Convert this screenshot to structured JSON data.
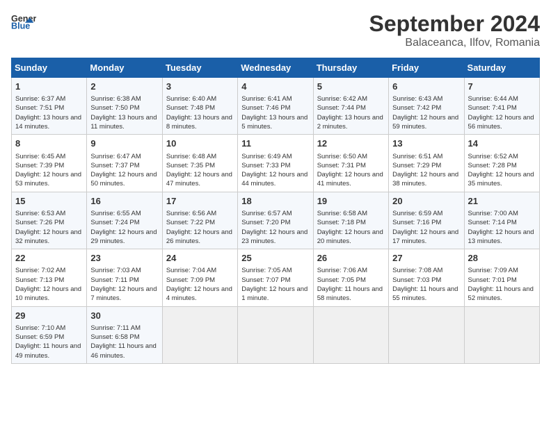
{
  "header": {
    "logo_general": "General",
    "logo_blue": "Blue",
    "month": "September 2024",
    "location": "Balaceanca, Ilfov, Romania"
  },
  "days_of_week": [
    "Sunday",
    "Monday",
    "Tuesday",
    "Wednesday",
    "Thursday",
    "Friday",
    "Saturday"
  ],
  "weeks": [
    [
      {
        "day": "1",
        "sunrise": "6:37 AM",
        "sunset": "7:51 PM",
        "daylight": "13 hours and 14 minutes."
      },
      {
        "day": "2",
        "sunrise": "6:38 AM",
        "sunset": "7:50 PM",
        "daylight": "13 hours and 11 minutes."
      },
      {
        "day": "3",
        "sunrise": "6:40 AM",
        "sunset": "7:48 PM",
        "daylight": "13 hours and 8 minutes."
      },
      {
        "day": "4",
        "sunrise": "6:41 AM",
        "sunset": "7:46 PM",
        "daylight": "13 hours and 5 minutes."
      },
      {
        "day": "5",
        "sunrise": "6:42 AM",
        "sunset": "7:44 PM",
        "daylight": "13 hours and 2 minutes."
      },
      {
        "day": "6",
        "sunrise": "6:43 AM",
        "sunset": "7:42 PM",
        "daylight": "12 hours and 59 minutes."
      },
      {
        "day": "7",
        "sunrise": "6:44 AM",
        "sunset": "7:41 PM",
        "daylight": "12 hours and 56 minutes."
      }
    ],
    [
      {
        "day": "8",
        "sunrise": "6:45 AM",
        "sunset": "7:39 PM",
        "daylight": "12 hours and 53 minutes."
      },
      {
        "day": "9",
        "sunrise": "6:47 AM",
        "sunset": "7:37 PM",
        "daylight": "12 hours and 50 minutes."
      },
      {
        "day": "10",
        "sunrise": "6:48 AM",
        "sunset": "7:35 PM",
        "daylight": "12 hours and 47 minutes."
      },
      {
        "day": "11",
        "sunrise": "6:49 AM",
        "sunset": "7:33 PM",
        "daylight": "12 hours and 44 minutes."
      },
      {
        "day": "12",
        "sunrise": "6:50 AM",
        "sunset": "7:31 PM",
        "daylight": "12 hours and 41 minutes."
      },
      {
        "day": "13",
        "sunrise": "6:51 AM",
        "sunset": "7:29 PM",
        "daylight": "12 hours and 38 minutes."
      },
      {
        "day": "14",
        "sunrise": "6:52 AM",
        "sunset": "7:28 PM",
        "daylight": "12 hours and 35 minutes."
      }
    ],
    [
      {
        "day": "15",
        "sunrise": "6:53 AM",
        "sunset": "7:26 PM",
        "daylight": "12 hours and 32 minutes."
      },
      {
        "day": "16",
        "sunrise": "6:55 AM",
        "sunset": "7:24 PM",
        "daylight": "12 hours and 29 minutes."
      },
      {
        "day": "17",
        "sunrise": "6:56 AM",
        "sunset": "7:22 PM",
        "daylight": "12 hours and 26 minutes."
      },
      {
        "day": "18",
        "sunrise": "6:57 AM",
        "sunset": "7:20 PM",
        "daylight": "12 hours and 23 minutes."
      },
      {
        "day": "19",
        "sunrise": "6:58 AM",
        "sunset": "7:18 PM",
        "daylight": "12 hours and 20 minutes."
      },
      {
        "day": "20",
        "sunrise": "6:59 AM",
        "sunset": "7:16 PM",
        "daylight": "12 hours and 17 minutes."
      },
      {
        "day": "21",
        "sunrise": "7:00 AM",
        "sunset": "7:14 PM",
        "daylight": "12 hours and 13 minutes."
      }
    ],
    [
      {
        "day": "22",
        "sunrise": "7:02 AM",
        "sunset": "7:13 PM",
        "daylight": "12 hours and 10 minutes."
      },
      {
        "day": "23",
        "sunrise": "7:03 AM",
        "sunset": "7:11 PM",
        "daylight": "12 hours and 7 minutes."
      },
      {
        "day": "24",
        "sunrise": "7:04 AM",
        "sunset": "7:09 PM",
        "daylight": "12 hours and 4 minutes."
      },
      {
        "day": "25",
        "sunrise": "7:05 AM",
        "sunset": "7:07 PM",
        "daylight": "12 hours and 1 minute."
      },
      {
        "day": "26",
        "sunrise": "7:06 AM",
        "sunset": "7:05 PM",
        "daylight": "11 hours and 58 minutes."
      },
      {
        "day": "27",
        "sunrise": "7:08 AM",
        "sunset": "7:03 PM",
        "daylight": "11 hours and 55 minutes."
      },
      {
        "day": "28",
        "sunrise": "7:09 AM",
        "sunset": "7:01 PM",
        "daylight": "11 hours and 52 minutes."
      }
    ],
    [
      {
        "day": "29",
        "sunrise": "7:10 AM",
        "sunset": "6:59 PM",
        "daylight": "11 hours and 49 minutes."
      },
      {
        "day": "30",
        "sunrise": "7:11 AM",
        "sunset": "6:58 PM",
        "daylight": "11 hours and 46 minutes."
      },
      null,
      null,
      null,
      null,
      null
    ]
  ]
}
